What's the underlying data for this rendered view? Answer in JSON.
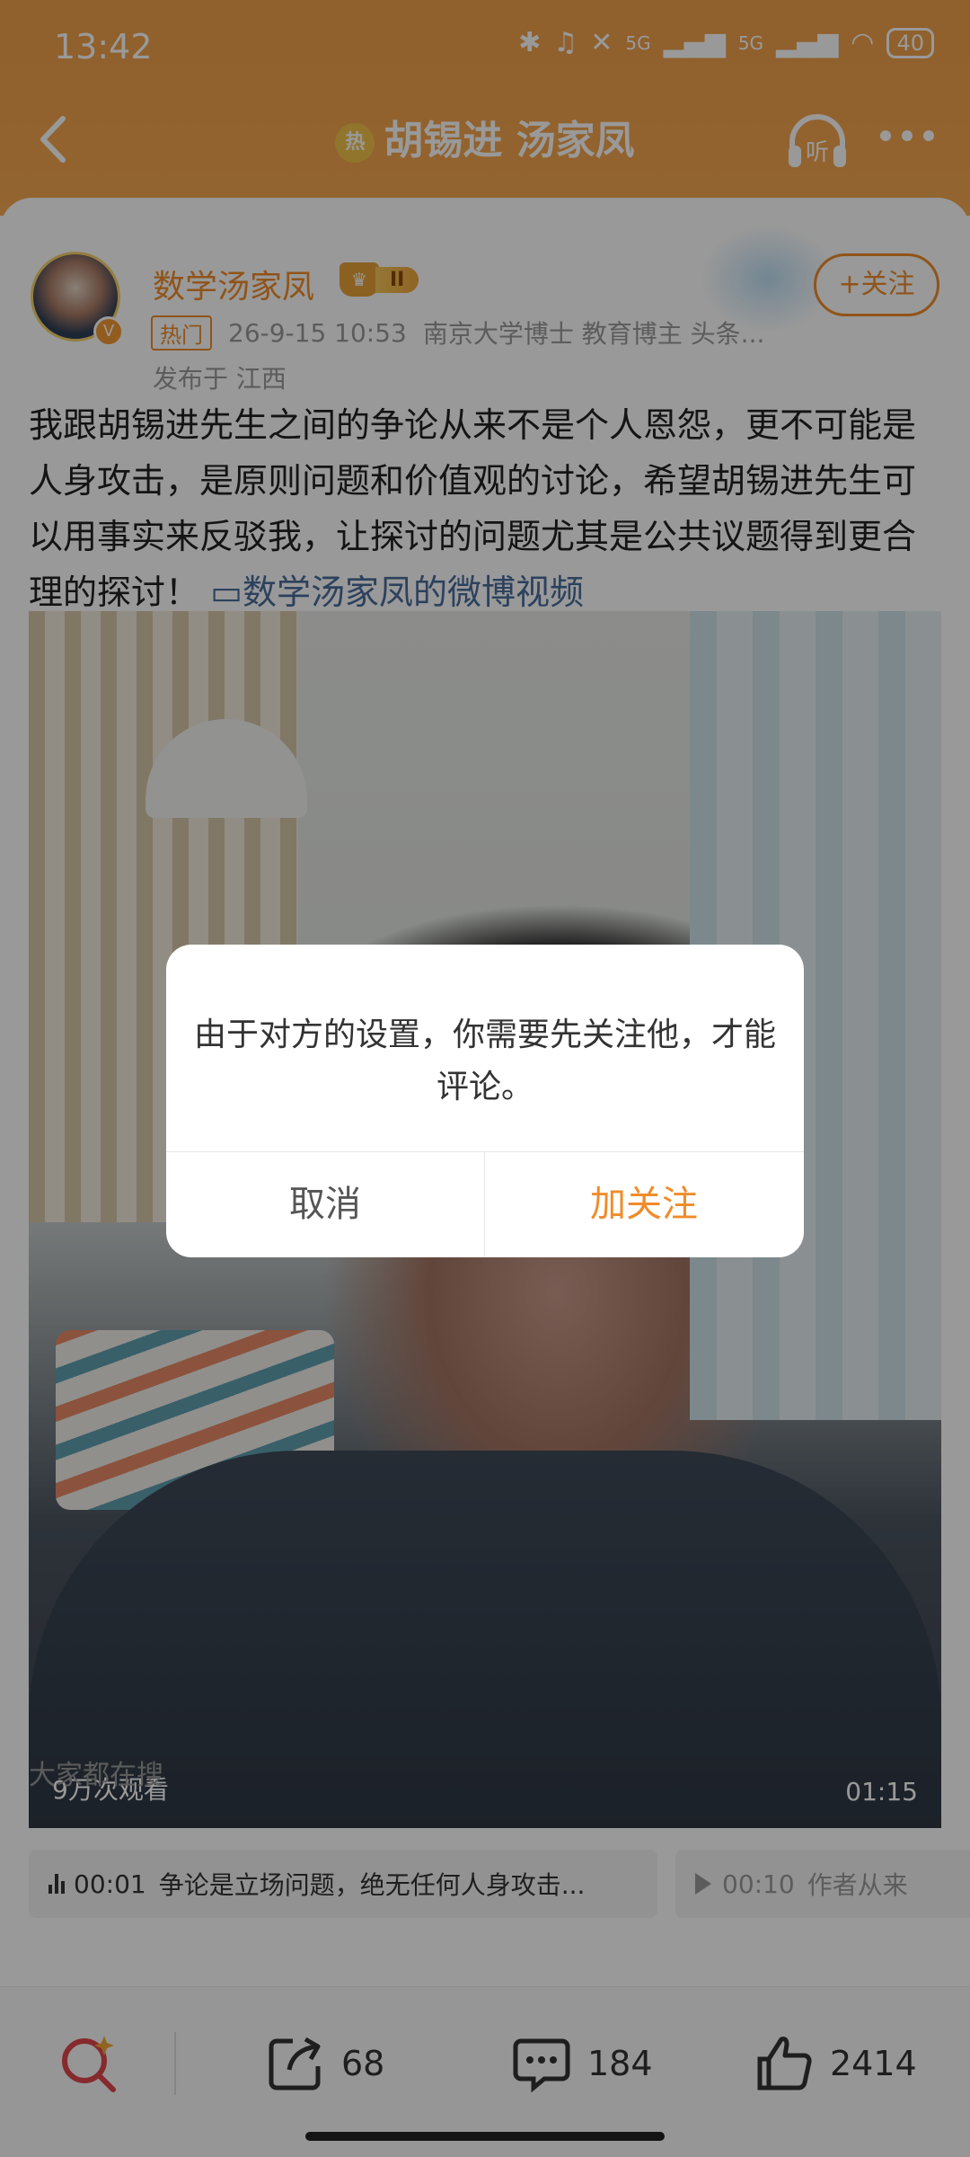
{
  "status_bar": {
    "time": "13:42",
    "battery": "40",
    "network_1": "5G",
    "network_2": "5G",
    "icons": [
      "bluetooth-icon",
      "earbuds-icon",
      "mute-icon",
      "signal-icon",
      "signal-icon",
      "wifi-icon",
      "battery-icon"
    ]
  },
  "nav": {
    "topic_title": "胡锡进 汤家凤",
    "hot_mark": "热",
    "listen_label": "听"
  },
  "post": {
    "username": "数学汤家凤",
    "vip_level": "II",
    "hot_tag": "热门",
    "timestamp": "26-9-15 10:53",
    "bio": "南京大学博士 教育博主 头条...",
    "location": "发布于 江西",
    "follow_label": "+关注",
    "text": "我跟胡锡进先生之间的争论从来不是个人恩怨，更不可能是人身攻击，是原则问题和价值观的讨论，希望胡锡进先生可以用事实来反驳我，让探讨的问题尤其是公共议题得到更合理的探讨！",
    "video_link": "数学汤家凤的微博视频"
  },
  "video": {
    "views": "9万次观看",
    "duration": "01:15"
  },
  "chapters": [
    {
      "time": "00:01",
      "title": "争论是立场问题，绝无任何人身攻击..."
    },
    {
      "time": "00:10",
      "title": "作者从来"
    }
  ],
  "search_hint": "大家都在搜",
  "bottom_bar": {
    "repost_count": "68",
    "comment_count": "184",
    "like_count": "2414"
  },
  "dialog": {
    "message": "由于对方的设置，你需要先关注他，才能评论。",
    "cancel_label": "取消",
    "confirm_label": "加关注"
  },
  "colors": {
    "accent": "#f08c2a",
    "header": "#f5a850",
    "link": "#4a6d9c"
  }
}
